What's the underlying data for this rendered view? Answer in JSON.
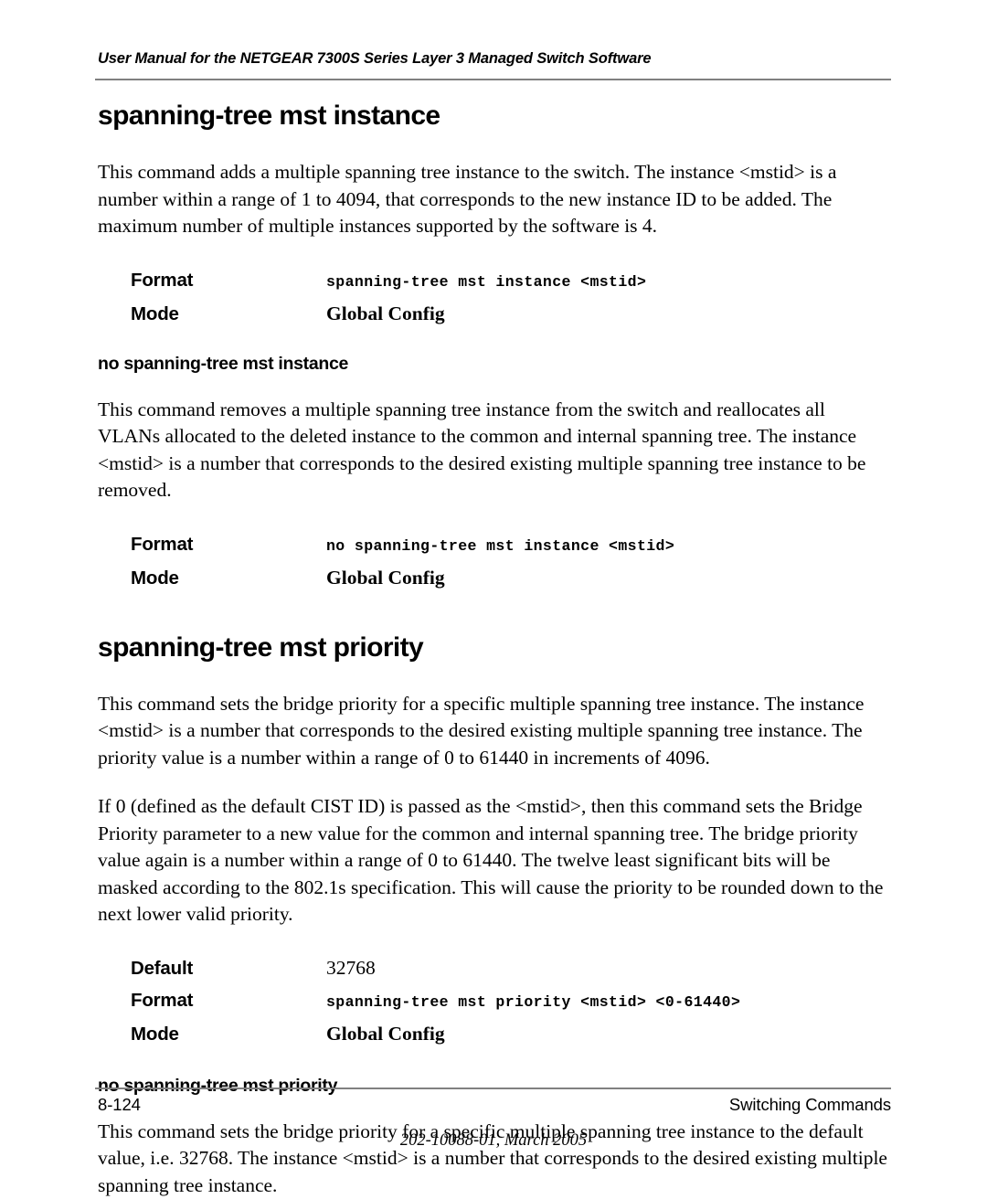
{
  "header": {
    "running_title": "User Manual for the NETGEAR 7300S Series Layer 3 Managed Switch Software"
  },
  "sections": [
    {
      "title": "spanning-tree mst instance",
      "paragraph": "This command adds a multiple spanning tree instance to the switch. The instance <mstid> is a number within a range of 1 to 4094, that corresponds to the new instance ID to be added. The maximum number of multiple instances supported by the software is 4.",
      "rows": [
        {
          "label": "Format",
          "value": "spanning-tree mst instance <mstid>"
        },
        {
          "label": "Mode",
          "value": "Global Config"
        }
      ],
      "subsection": {
        "title": "no spanning-tree mst instance",
        "paragraph": "This command removes a multiple spanning tree instance from the switch and reallocates all VLANs allocated to the deleted instance to the common and internal spanning tree. The instance <mstid> is a number that corresponds to the desired existing multiple spanning tree instance to be removed.",
        "rows": [
          {
            "label": "Format",
            "value": "no spanning-tree mst instance <mstid>"
          },
          {
            "label": "Mode",
            "value": "Global Config"
          }
        ]
      }
    },
    {
      "title": "spanning-tree mst priority",
      "paragraph": "This command sets the bridge priority for a specific multiple spanning tree instance. The instance <mstid> is a number that corresponds to the desired existing multiple spanning tree instance. The priority value is a number within a range of 0 to 61440 in increments of 4096.",
      "paragraph2": "If 0 (defined as the default CIST ID) is passed as the <mstid>, then this command sets the Bridge Priority parameter to a new value for the common and internal spanning tree. The bridge priority value again is a number within a range of 0 to 61440.  The twelve least significant bits will be masked according to the 802.1s specification.  This will cause the priority to be rounded down to the next lower valid priority.",
      "rows": [
        {
          "label": "Default",
          "value": "32768"
        },
        {
          "label": "Format",
          "value": "spanning-tree mst priority <mstid> <0-61440>"
        },
        {
          "label": "Mode",
          "value": "Global Config"
        }
      ],
      "subsection": {
        "title": "no spanning-tree mst priority",
        "paragraph": "This command sets the bridge priority for a specific multiple spanning tree instance to the default value, i.e. 32768. The instance <mstid> is a number that corresponds to the desired existing multiple spanning tree instance."
      }
    }
  ],
  "footer": {
    "page_number": "8-124",
    "chapter_title": "Switching Commands",
    "document_id": "202-10088-01, March 2005"
  },
  "colors": {
    "rule": "#808080",
    "text": "#000000",
    "background": "#ffffff"
  }
}
